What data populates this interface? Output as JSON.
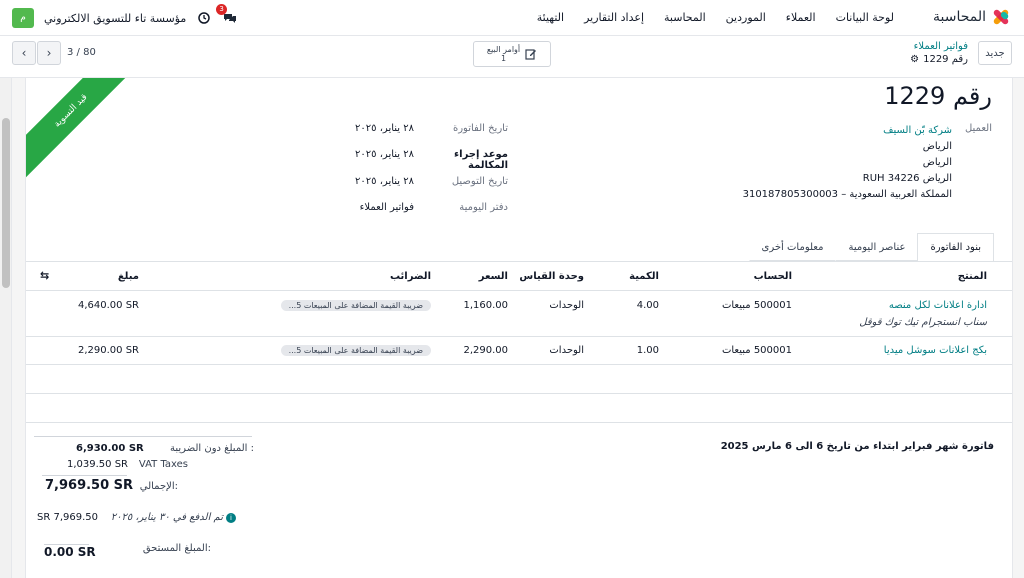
{
  "app": {
    "name": "المحاسبة",
    "menu": [
      "لوحة البيانات",
      "العملاء",
      "الموردين",
      "المحاسبة",
      "إعداد التقارير",
      "التهيئة"
    ]
  },
  "company": {
    "badge": "م",
    "name": "مؤسسة تاء للتسويق الالكتروني",
    "notif_count": "3"
  },
  "control": {
    "new_label": "جديد",
    "breadcrumb_parent": "فواتير العملاء",
    "breadcrumb_current": "رقم 1229",
    "smart_button_label": "أوامر البيع",
    "smart_button_count": "1",
    "pager": "3 / 80"
  },
  "invoice": {
    "ribbon": "قيد التسوية",
    "title": "رقم 1229",
    "customer_label": "العميل",
    "customer": {
      "name": "شركة بّن السيف",
      "line1": "الرياض",
      "line2": "الرياض",
      "line3": "الرياض RUH 34226",
      "line4": "المملكة العربية السعودية – 310187805300003"
    },
    "fields": [
      {
        "label": "تاريخ الفاتورة",
        "value": "٢٨ يناير، ٢٠٢٥"
      },
      {
        "label": "موعد إجراء المكالمة",
        "value": "٢٨ يناير، ٢٠٢٥"
      },
      {
        "label": "تاريخ التوصيل",
        "value": "٢٨ يناير، ٢٠٢٥"
      },
      {
        "label": "دفتر اليومية",
        "value": "فواتير العملاء"
      }
    ]
  },
  "tabs": [
    "بنود الفاتورة",
    "عناصر اليومية",
    "معلومات أخرى"
  ],
  "table": {
    "headers": {
      "product": "المنتج",
      "account": "الحساب",
      "qty": "الكمية",
      "uom": "وحدة القياس",
      "price": "السعر",
      "taxes": "الضرائب",
      "amount": "مبلغ"
    },
    "rows": [
      {
        "product": "ادارة اعلانات لكل منصه",
        "description": "سناب انستجرام تيك توك قوقل",
        "account": "500001 مبيعات",
        "qty": "4.00",
        "uom": "الوحدات",
        "price": "1,160.00",
        "taxes": "ضريبة القيمة المضافة على المبيعات 5...",
        "amount": "4,640.00 SR"
      },
      {
        "product": "بكج اعلانات سوشل ميديا",
        "description": "",
        "account": "500001 مبيعات",
        "qty": "1.00",
        "uom": "الوحدات",
        "price": "2,290.00",
        "taxes": "ضريبة القيمة المضافة على المبيعات 5...",
        "amount": "2,290.00 SR"
      }
    ]
  },
  "totals": {
    "untaxed_label": "المبلغ دون الضريبة :",
    "untaxed": "6,930.00 SR",
    "vat_label": "VAT Taxes",
    "vat": "1,039.50 SR",
    "total_label": "الإجمالي:",
    "total": "7,969.50 SR",
    "paid_label": "تم الدفع في ٣٠ يناير، ٢٠٢٥",
    "paid": "SR 7,969.50",
    "due_label": "المبلغ المستحق:",
    "due": "0.00 SR"
  },
  "note": "فاتورة شهر فبراير ابتداء من تاريخ  6   الى 6 مارس 2025",
  "colors": {
    "accent": "#017e84",
    "ribbon": "#28a745",
    "badge": "#52b94e",
    "notif": "#dc2626"
  }
}
